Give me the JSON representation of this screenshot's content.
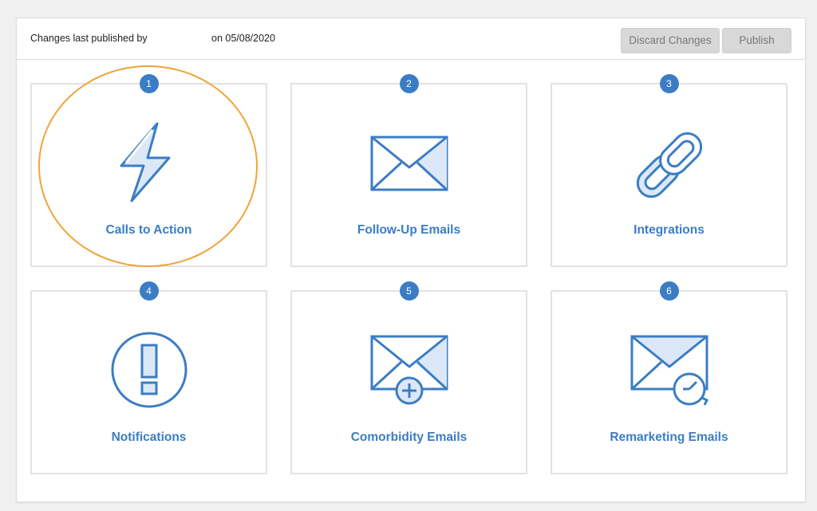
{
  "header": {
    "published_prefix": "Changes last published by",
    "published_date": "on 05/08/2020",
    "discard_label": "Discard Changes",
    "publish_label": "Publish"
  },
  "cards": [
    {
      "number": "1",
      "label": "Calls to Action",
      "icon": "lightning-bolt-icon"
    },
    {
      "number": "2",
      "label": "Follow-Up Emails",
      "icon": "envelope-icon"
    },
    {
      "number": "3",
      "label": "Integrations",
      "icon": "chain-link-icon"
    },
    {
      "number": "4",
      "label": "Notifications",
      "icon": "exclamation-icon"
    },
    {
      "number": "5",
      "label": "Comorbidity Emails",
      "icon": "envelope-plus-icon"
    },
    {
      "number": "6",
      "label": "Remarketing Emails",
      "icon": "envelope-clock-icon"
    }
  ],
  "colors": {
    "accent": "#3b7dc4",
    "icon_fill": "#dce8f7",
    "highlight": "#f0a43a"
  }
}
